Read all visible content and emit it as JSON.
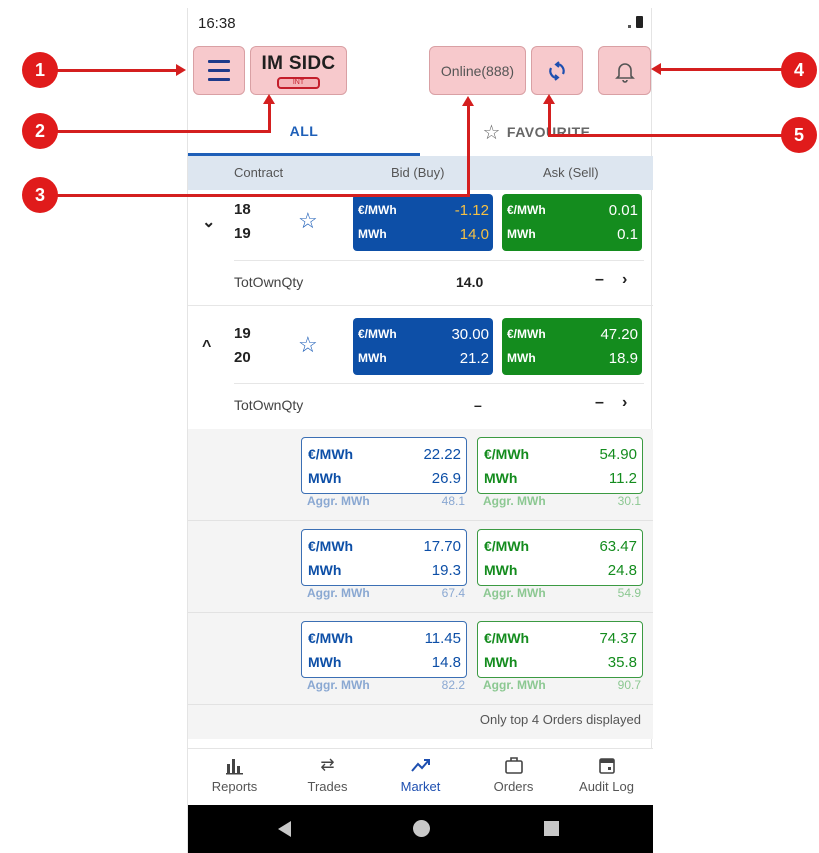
{
  "status_bar": {
    "time": "16:38"
  },
  "header": {
    "brand_title": "IM SIDC",
    "brand_badge": "INT",
    "online_label": "Online(888)",
    "sync_icon": "refresh-icon",
    "bell_icon": "bell-icon",
    "menu_icon": "menu-icon"
  },
  "tabs": {
    "all": "ALL",
    "favourite": "FAVOURITE"
  },
  "columns": {
    "contract": "Contract",
    "bid": "Bid (Buy)",
    "ask": "Ask (Sell)"
  },
  "contracts": [
    {
      "from": "18",
      "to": "19",
      "bid": {
        "price_label": "€/MWh",
        "price": "-1.12",
        "qty_label": "MWh",
        "qty": "14.0"
      },
      "ask": {
        "price_label": "€/MWh",
        "price": "0.01",
        "qty_label": "MWh",
        "qty": "0.1"
      },
      "own_label": "TotOwnQty",
      "own_value": "14.0",
      "own_dash": "–",
      "expanded": false
    },
    {
      "from": "19",
      "to": "20",
      "bid": {
        "price_label": "€/MWh",
        "price": "30.00",
        "qty_label": "MWh",
        "qty": "21.2"
      },
      "ask": {
        "price_label": "€/MWh",
        "price": "47.20",
        "qty_label": "MWh",
        "qty": "18.9"
      },
      "own_label": "TotOwnQty",
      "own_value": "–",
      "own_dash": "–",
      "expanded": true
    }
  ],
  "orders": [
    {
      "bid_price": "22.22",
      "bid_qty": "26.9",
      "bid_aggr": "48.1",
      "ask_price": "54.90",
      "ask_qty": "11.2",
      "ask_aggr": "30.1"
    },
    {
      "bid_price": "17.70",
      "bid_qty": "19.3",
      "bid_aggr": "67.4",
      "ask_price": "63.47",
      "ask_qty": "24.8",
      "ask_aggr": "54.9"
    },
    {
      "bid_price": "11.45",
      "bid_qty": "14.8",
      "bid_aggr": "82.2",
      "ask_price": "74.37",
      "ask_qty": "35.8",
      "ask_aggr": "90.7"
    }
  ],
  "order_labels": {
    "price": "€/MWh",
    "qty": "MWh",
    "aggr": "Aggr. MWh"
  },
  "only_top": "Only top 4 Orders displayed",
  "bottom_nav": [
    {
      "label": "Reports",
      "icon": "bar-chart-icon"
    },
    {
      "label": "Trades",
      "icon": "swap-icon"
    },
    {
      "label": "Market",
      "icon": "trending-up-icon"
    },
    {
      "label": "Orders",
      "icon": "briefcase-icon"
    },
    {
      "label": "Audit Log",
      "icon": "calendar-icon"
    }
  ],
  "callouts": [
    "1",
    "2",
    "3",
    "4",
    "5"
  ],
  "colors": {
    "bid": "#0d4fa7",
    "ask": "#148c1e",
    "callout": "#e01b1b",
    "header_btn": "#f7c9cc"
  }
}
